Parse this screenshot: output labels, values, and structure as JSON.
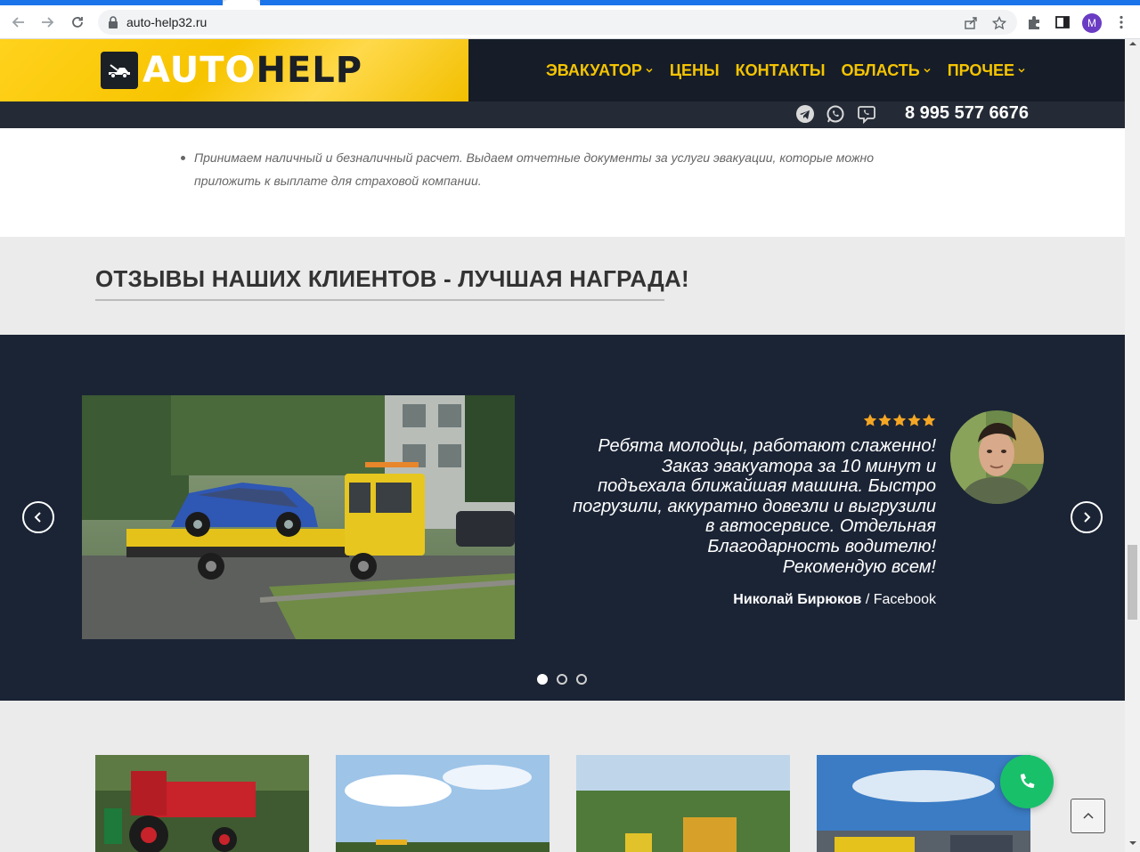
{
  "browser": {
    "url": "auto-help32.ru",
    "profile_initial": "M"
  },
  "header": {
    "logo_auto": "AUTO",
    "logo_help": "HELP",
    "nav": [
      {
        "label": "ЭВАКУАТОР",
        "has_dropdown": true
      },
      {
        "label": "ЦЕНЫ",
        "has_dropdown": false
      },
      {
        "label": "КОНТАКТЫ",
        "has_dropdown": false
      },
      {
        "label": "ОБЛАСТЬ",
        "has_dropdown": true
      },
      {
        "label": "ПРОЧЕЕ",
        "has_dropdown": true
      }
    ],
    "phone": "8 995 577 6676",
    "socials": [
      "telegram-icon",
      "whatsapp-icon",
      "viber-icon"
    ]
  },
  "content": {
    "bullet_text": "Принимаем наличный и безналичный расчет. Выдаем отчетные документы за услуги эвакуации, которые можно приложить к выплате для страховой компании."
  },
  "reviews": {
    "title": "ОТЗЫВЫ НАШИХ КЛИЕНТОВ - ЛУЧШАЯ НАГРАДА!",
    "rating": 5,
    "quote_lines": [
      "Ребята молодцы, работают слаженно!",
      "Заказ эвакуатора за 10 минут и",
      "подъехала ближайшая машина. Быстро",
      "погрузили, аккуратно довезли и выгрузили",
      "в автосервисе. Отдельная",
      "Благодарность водителю!",
      "Рекомендую всем!"
    ],
    "author_name": "Николай Бирюков",
    "author_source": " / Facebook",
    "slides_total": 3,
    "active_slide": 1
  },
  "colors": {
    "brand_yellow": "#f5c400",
    "dark_navy": "#1b2435",
    "call_green": "#18c06a"
  }
}
